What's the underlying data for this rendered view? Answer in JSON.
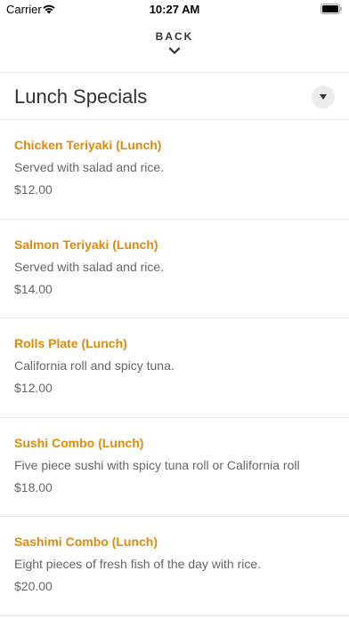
{
  "status": {
    "carrier": "Carrier",
    "time": "10:27 AM"
  },
  "nav": {
    "back_label": "BACK"
  },
  "section": {
    "title": "Lunch Specials"
  },
  "items": [
    {
      "name": "Chicken Teriyaki (Lunch)",
      "description": "Served with salad and rice.",
      "price": "$12.00"
    },
    {
      "name": "Salmon Teriyaki (Lunch)",
      "description": "Served with salad and rice.",
      "price": "$14.00"
    },
    {
      "name": "Rolls Plate (Lunch)",
      "description": "California roll and spicy tuna.",
      "price": "$12.00"
    },
    {
      "name": "Sushi Combo (Lunch)",
      "description": "Five piece sushi with spicy tuna roll or California roll",
      "price": "$18.00"
    },
    {
      "name": "Sashimi Combo (Lunch)",
      "description": "Eight pieces of fresh fish of the day with rice.",
      "price": "$20.00"
    }
  ],
  "colors": {
    "accent": "#e08a0b",
    "text": "#333333",
    "muted": "#666666",
    "divider": "#e6e6e6"
  },
  "icons": [
    "wifi-icon",
    "battery-icon",
    "chevron-down-icon",
    "dropdown-triangle-icon"
  ]
}
